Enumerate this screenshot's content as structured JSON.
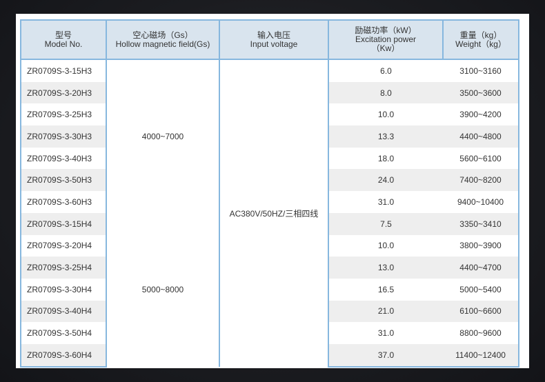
{
  "headers": {
    "model": [
      "型号",
      "Model No."
    ],
    "field": [
      "空心磁场（Gs）",
      "Hollow magnetic field(Gs)"
    ],
    "voltage": [
      "输入电压",
      "Input voltage"
    ],
    "power": [
      "励磁功率（kW）",
      "Excitation power",
      "（Kw）"
    ],
    "weight": [
      "重量（kg）",
      "Weight（kg）"
    ]
  },
  "field_groups": [
    "4000~7000",
    "5000~8000"
  ],
  "voltage_value": "AC380V/50HZ/三相四线",
  "rows": [
    {
      "model": "ZR0709S-3-15H3",
      "power": "6.0",
      "weight": "3100~3160"
    },
    {
      "model": "ZR0709S-3-20H3",
      "power": "8.0",
      "weight": "3500~3600"
    },
    {
      "model": "ZR0709S-3-25H3",
      "power": "10.0",
      "weight": "3900~4200"
    },
    {
      "model": "ZR0709S-3-30H3",
      "power": "13.3",
      "weight": "4400~4800"
    },
    {
      "model": "ZR0709S-3-40H3",
      "power": "18.0",
      "weight": "5600~6100"
    },
    {
      "model": "ZR0709S-3-50H3",
      "power": "24.0",
      "weight": "7400~8200"
    },
    {
      "model": "ZR0709S-3-60H3",
      "power": "31.0",
      "weight": "9400~10400"
    },
    {
      "model": "ZR0709S-3-15H4",
      "power": "7.5",
      "weight": "3350~3410"
    },
    {
      "model": "ZR0709S-3-20H4",
      "power": "10.0",
      "weight": "3800~3900"
    },
    {
      "model": "ZR0709S-3-25H4",
      "power": "13.0",
      "weight": "4400~4700"
    },
    {
      "model": "ZR0709S-3-30H4",
      "power": "16.5",
      "weight": "5000~5400"
    },
    {
      "model": "ZR0709S-3-40H4",
      "power": "21.0",
      "weight": "6100~6600"
    },
    {
      "model": "ZR0709S-3-50H4",
      "power": "31.0",
      "weight": "8800~9600"
    },
    {
      "model": "ZR0709S-3-60H4",
      "power": "37.0",
      "weight": "11400~12400"
    }
  ]
}
